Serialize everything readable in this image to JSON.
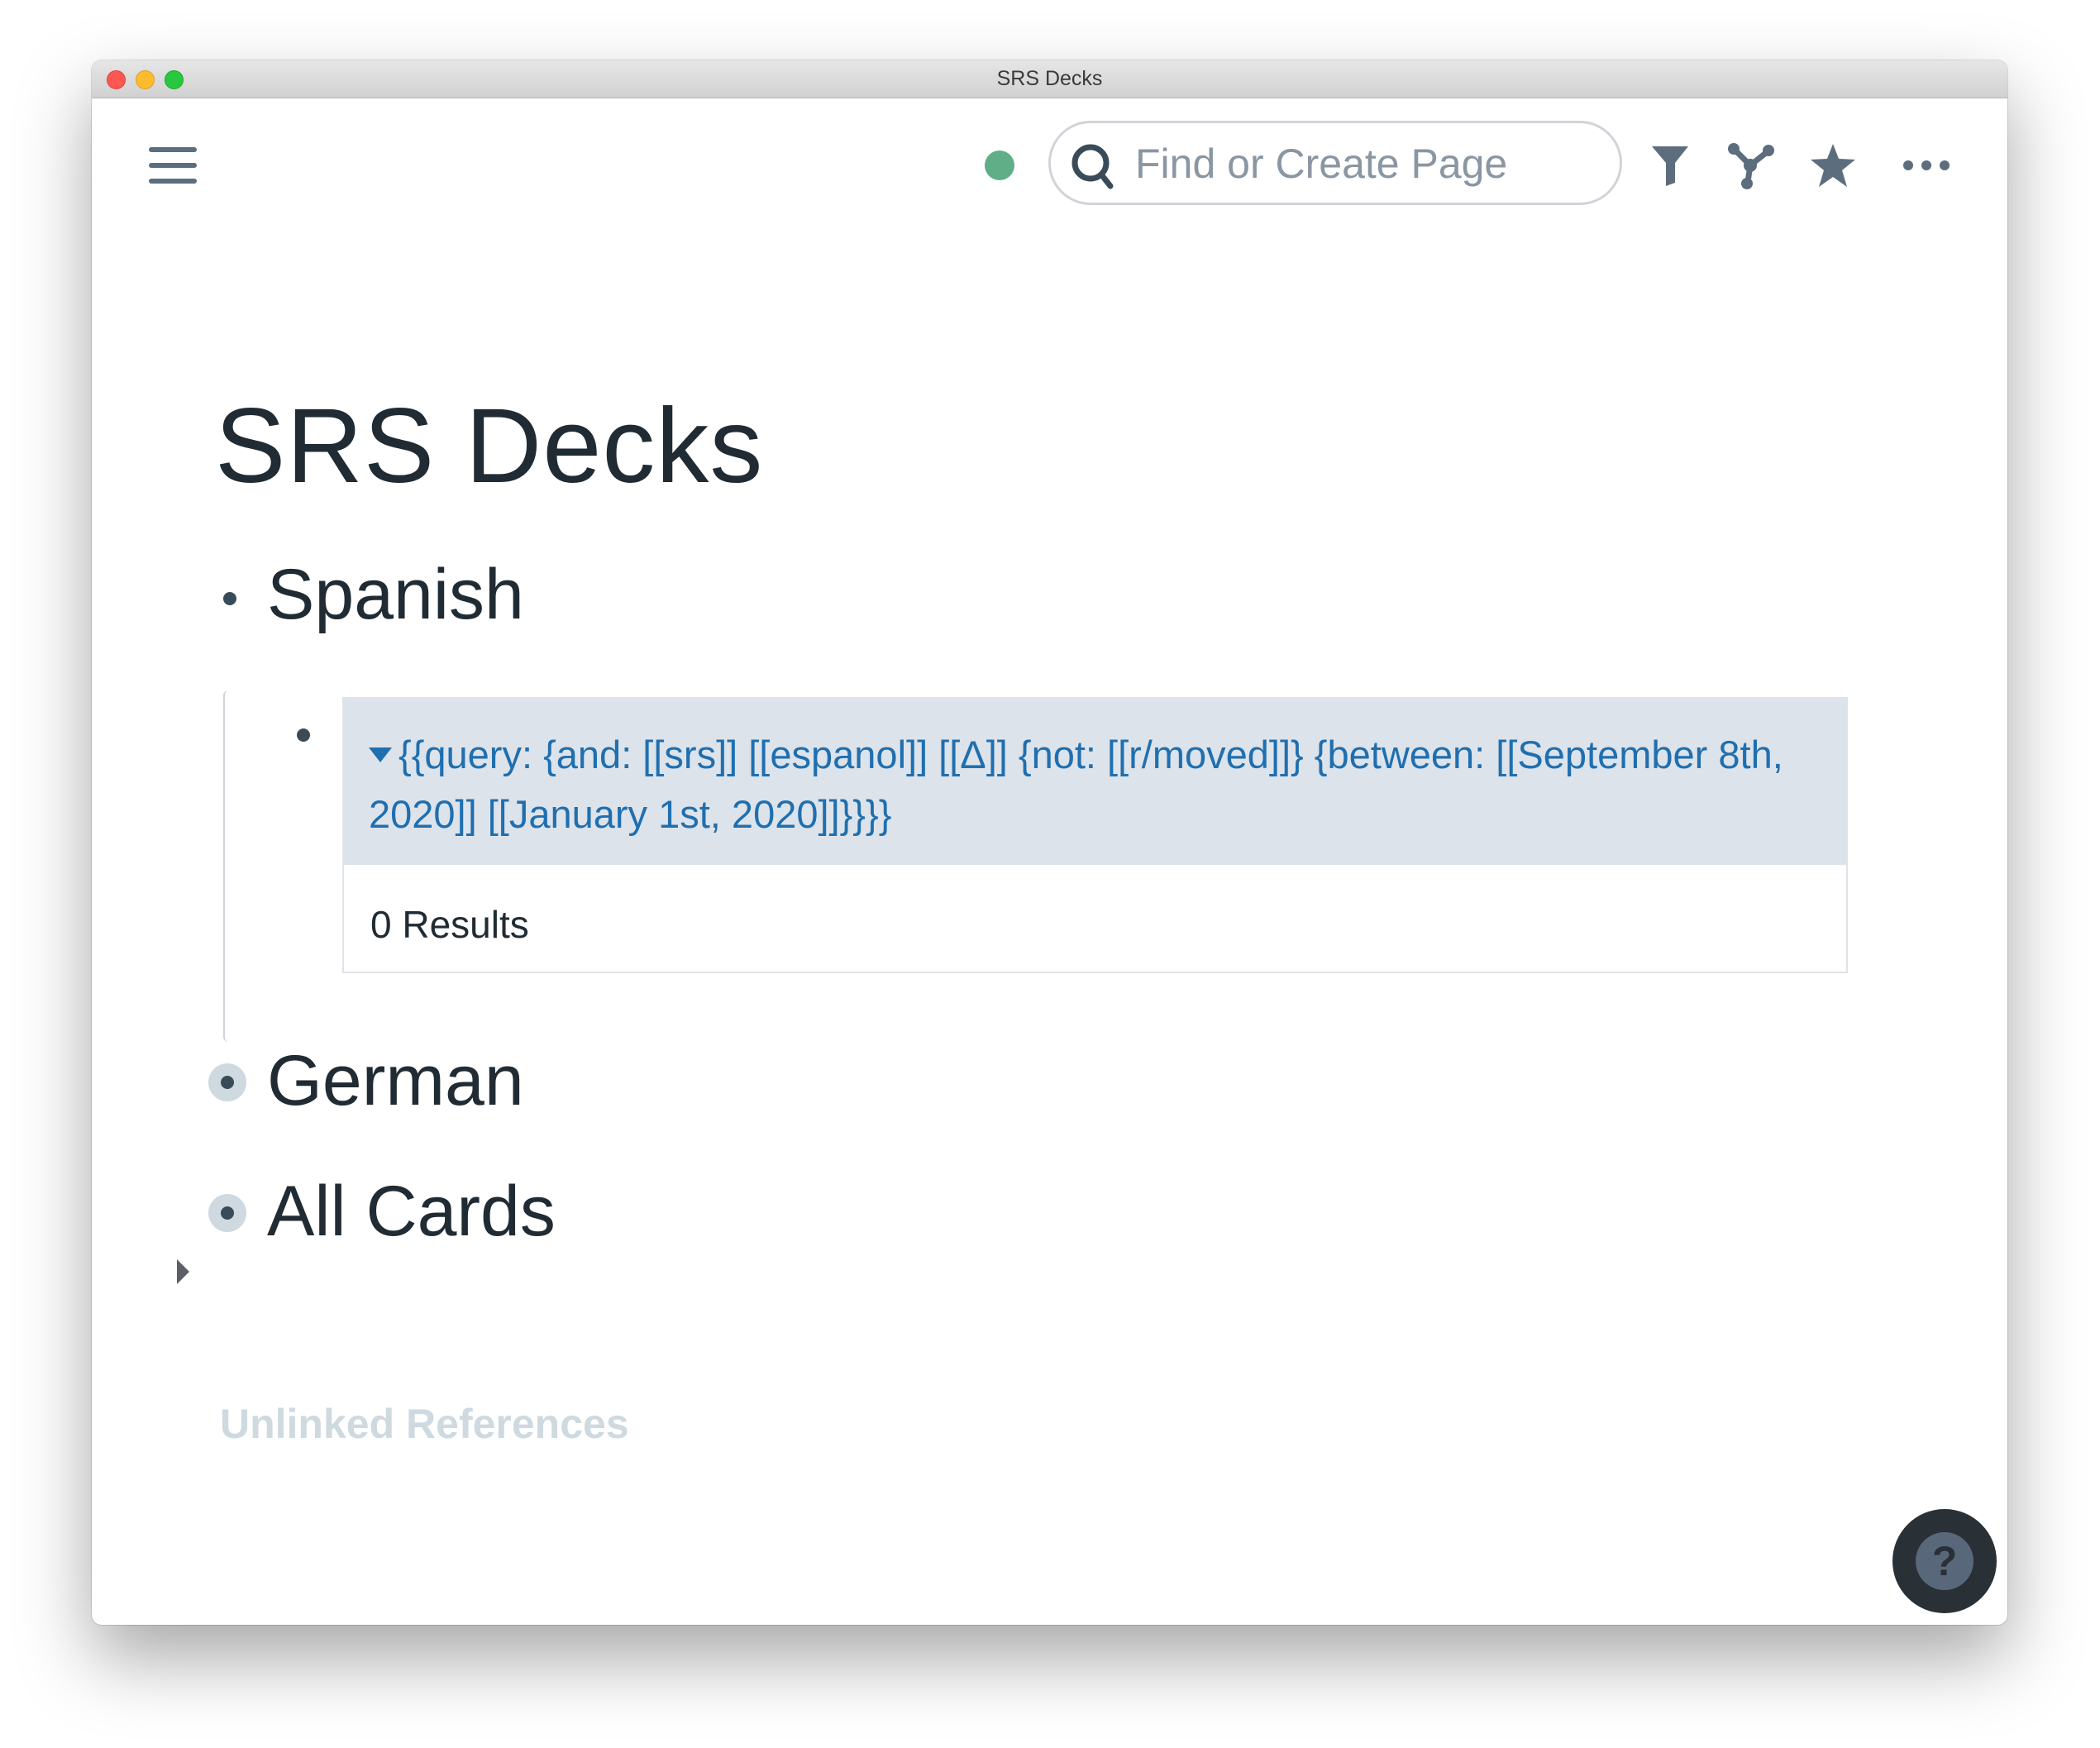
{
  "window": {
    "title": "SRS Decks"
  },
  "toolbar": {
    "search_placeholder": "Find or Create Page",
    "sync_status_color": "#5fae88",
    "icons": [
      "menu-icon",
      "sync-status-dot",
      "search-icon",
      "filter-icon",
      "graph-icon",
      "star-icon",
      "more-icon"
    ]
  },
  "page": {
    "title": "SRS Decks",
    "blocks": [
      {
        "text": "Spanish",
        "children": [
          {
            "query_text": "{{query:  {and: [[srs]] [[espanol]] [[Δ]] {not: [[r/moved]]} {between: [[September 8th, 2020]] [[January 1st, 2020]]}}}}",
            "results": "0 Results"
          }
        ]
      },
      {
        "text": "German",
        "collapsed": false
      },
      {
        "text": "All Cards",
        "collapsed": true
      }
    ],
    "unlinked_references": "Unlinked References"
  },
  "help": {
    "label": "?"
  },
  "colors": {
    "link": "#1f6fb0",
    "query_bg": "#dde3ea",
    "text": "#202b33",
    "muted": "#ced9e0"
  }
}
